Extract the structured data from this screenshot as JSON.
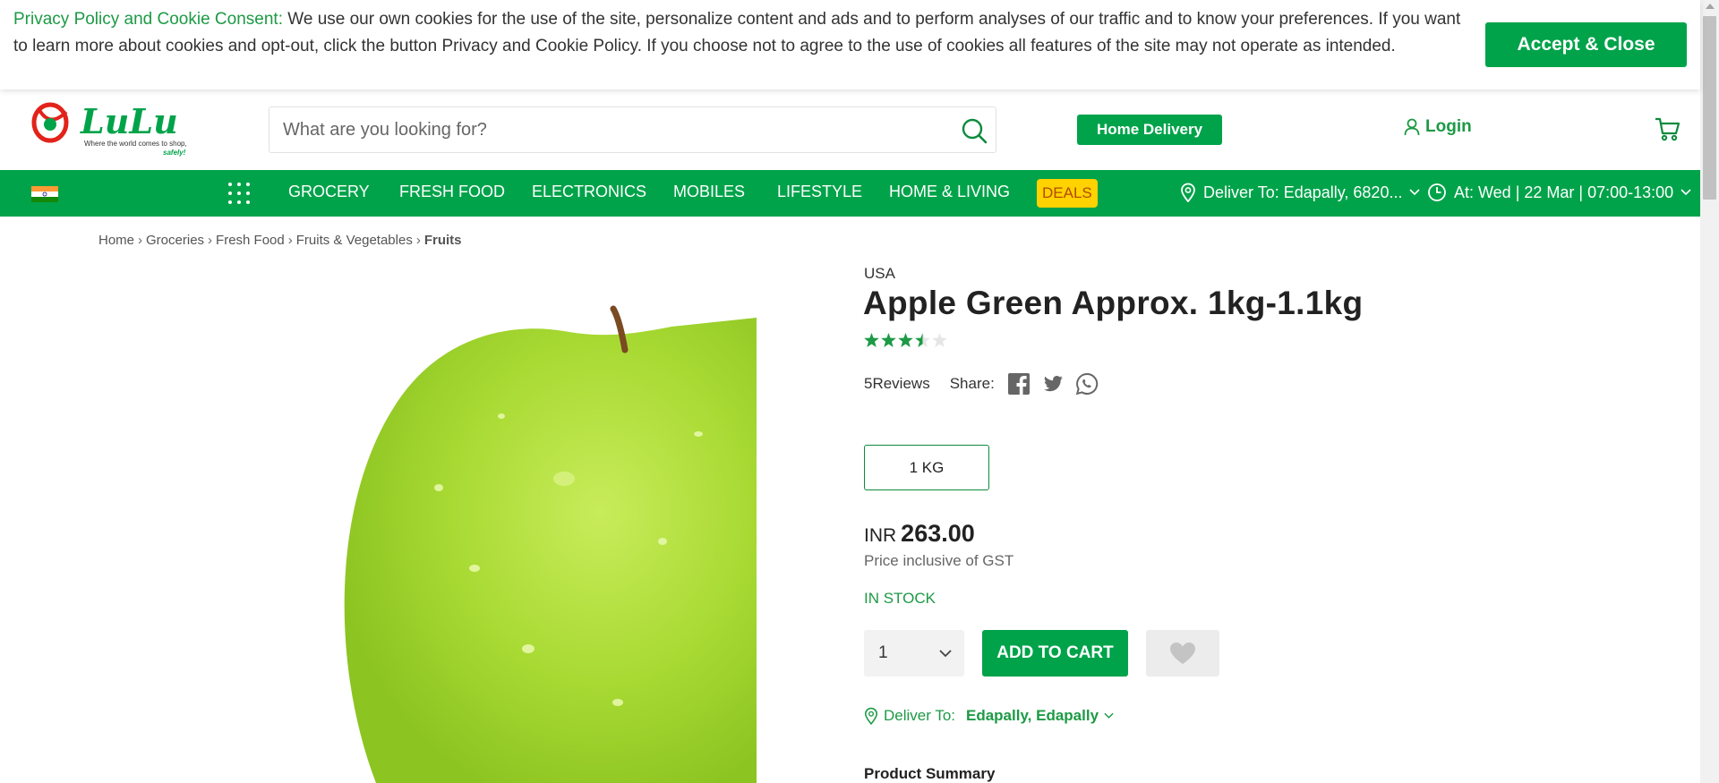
{
  "cookie": {
    "lead": "Privacy Policy and Cookie Consent:",
    "text": " We use our own cookies for the use of the site, personalize content and ads and to perform analyses of our traffic and to know your preferences. If you want to learn more about cookies and opt-out, click the button Privacy and Cookie Policy. If you choose not to agree to the use of cookies all features of the site may not operate as intended.",
    "accept_label": "Accept & Close"
  },
  "header": {
    "logo_text": "LuLu",
    "logo_tagline": "Where the world comes to shop,",
    "logo_safely": "safely!",
    "search_placeholder": "What are you looking for?",
    "home_delivery_label": "Home Delivery",
    "login_label": "Login"
  },
  "nav": {
    "items": [
      "GROCERY",
      "FRESH FOOD",
      "ELECTRONICS",
      "MOBILES",
      "LIFESTYLE",
      "HOME & LIVING"
    ],
    "deals_label": "DEALS",
    "deliver_to": "Deliver To: Edapally, 6820...",
    "at_time": "At: Wed | 22 Mar | 07:00-13:00"
  },
  "breadcrumb": [
    "Home",
    "Groceries",
    "Fresh Food",
    "Fruits & Vegetables",
    "Fruits"
  ],
  "product": {
    "origin": "USA",
    "title": "Apple Green Approx. 1kg-1.1kg",
    "rating": 3.5,
    "rating_max": 5,
    "reviews": "5Reviews",
    "share_label": "Share:",
    "size": "1 KG",
    "currency": "INR",
    "price": "263.00",
    "gst_note": "Price inclusive of GST",
    "stock": "IN STOCK",
    "quantity": "1",
    "add_to_cart_label": "ADD TO CART",
    "deliver_label": "Deliver To:",
    "deliver_location": "Edapally, Edapally",
    "summary_heading": "Product Summary"
  },
  "colors": {
    "brand_green": "#00a34a",
    "link_green": "#1d9a45",
    "deals_bg": "#ffd200"
  }
}
